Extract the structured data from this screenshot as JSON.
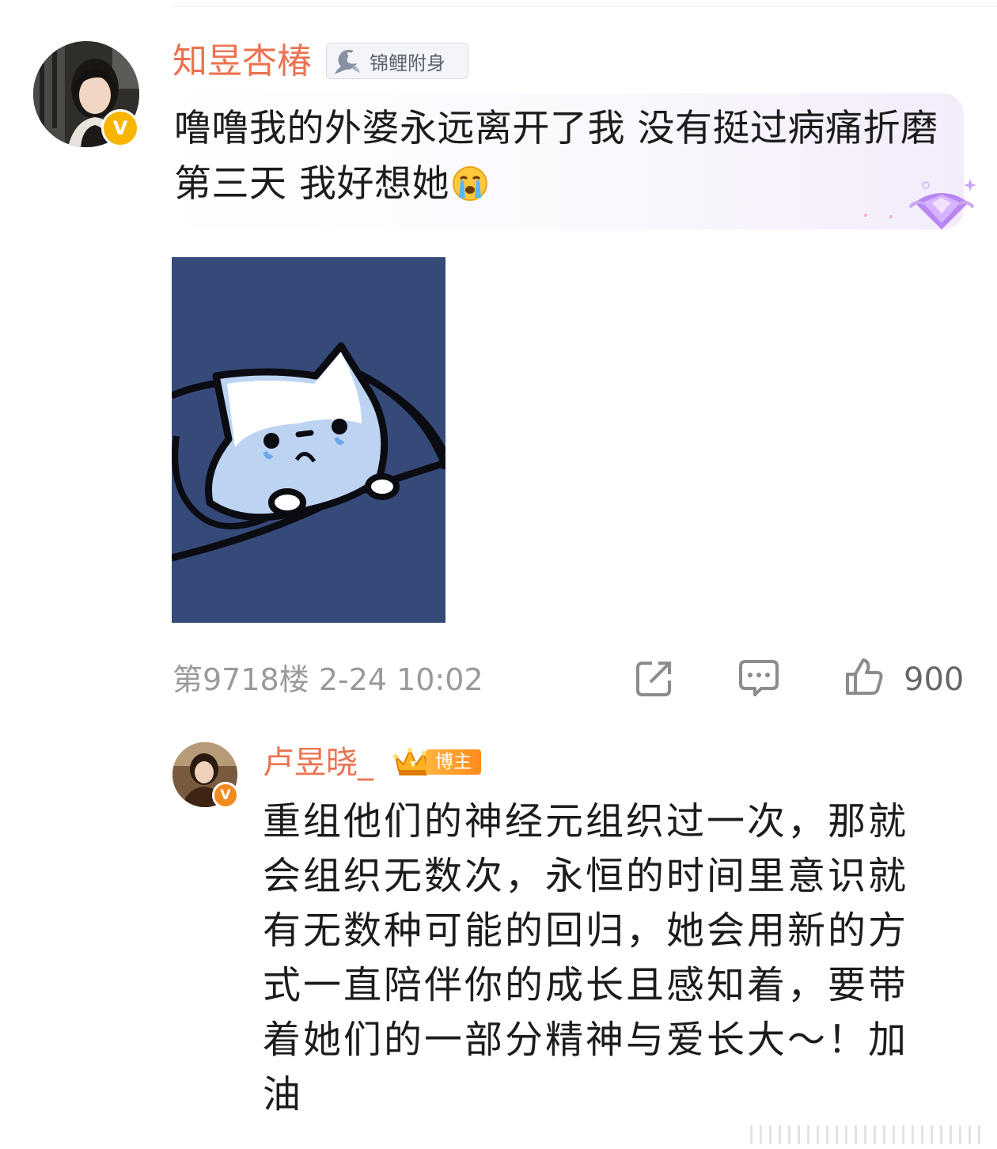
{
  "main_comment": {
    "username": "知昱杏椿",
    "tag_label": "锦鲤附身",
    "text": "噜噜我的外婆永远离开了我 没有挺过病痛折磨 第三天 我好想她",
    "emoji": "crying-face-icon",
    "image": "cat-sticker",
    "floor": "第9718楼",
    "time": "2-24 10:02",
    "likes": "900"
  },
  "reply": {
    "username": "卢昱晓_",
    "tag_label": "博主",
    "text": "重组他们的神经元组织过一次，那就会组织无数次，永恒的时间里意识就有无数种可能的回归，她会用新的方式一直陪伴你的成长且感知着，要带着她们的一部分精神与爱长大～！加油"
  },
  "colors": {
    "username": "#eb7350",
    "verified_gold": "#f7b500",
    "verified_orange": "#f28a1e",
    "meta_gray": "#9a9a9a",
    "image_bg": "#364a7a"
  }
}
